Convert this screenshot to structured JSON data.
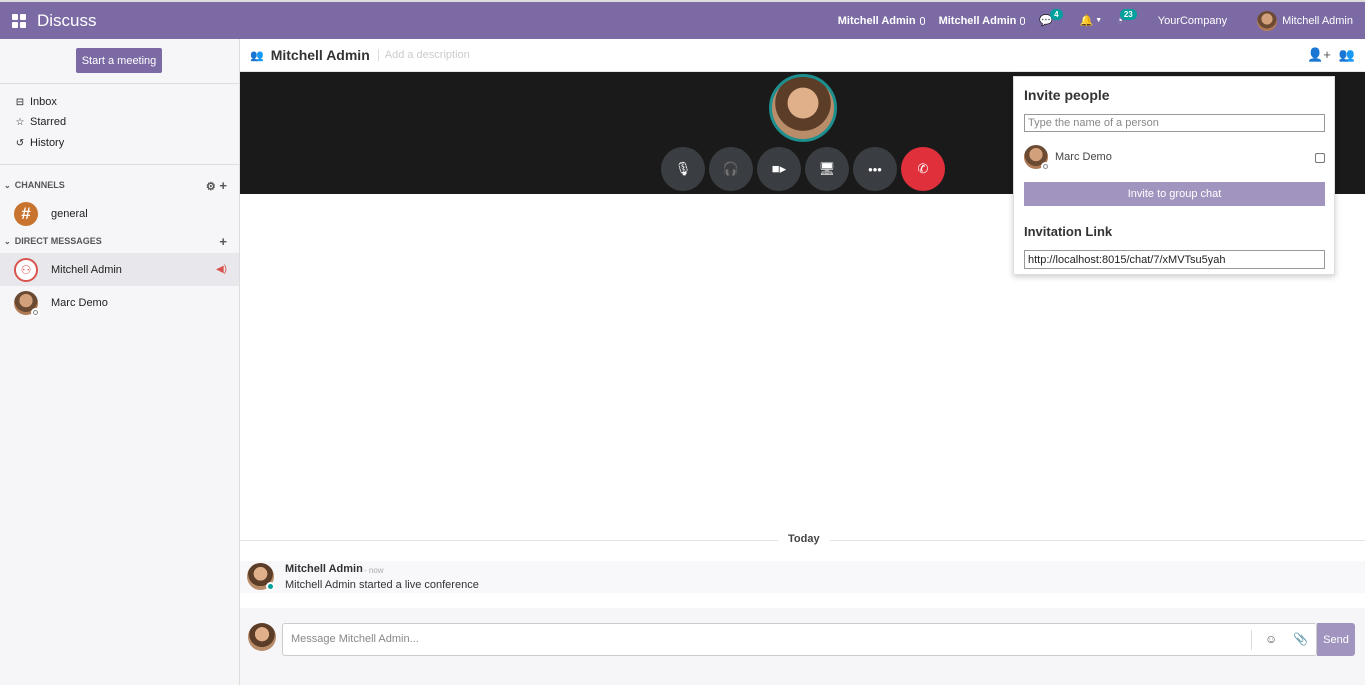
{
  "app": {
    "title": "Discuss"
  },
  "topbar": {
    "call_user_1": "Mitchell Admin",
    "call_user_2": "Mitchell Admin",
    "messages_badge": "4",
    "activities_badge": "23",
    "company": "YourCompany",
    "user": "Mitchell Admin"
  },
  "sidebar": {
    "start_meeting": "Start a meeting",
    "nav": [
      {
        "label": "Inbox",
        "icon": "inbox-icon"
      },
      {
        "label": "Starred",
        "icon": "star-icon"
      },
      {
        "label": "History",
        "icon": "history-icon"
      }
    ],
    "channels_header": "CHANNELS",
    "channels": [
      {
        "label": "general"
      }
    ],
    "dm_header": "DIRECT MESSAGES",
    "direct_messages": [
      {
        "label": "Mitchell Admin",
        "active": true
      },
      {
        "label": "Marc Demo",
        "active": false
      }
    ]
  },
  "thread": {
    "title": "Mitchell Admin",
    "description_placeholder": "Add a description"
  },
  "invite": {
    "title": "Invite people",
    "search_placeholder": "Type the name of a person",
    "people": [
      {
        "name": "Marc Demo",
        "checked": false
      }
    ],
    "invite_button": "Invite to group chat",
    "link_title": "Invitation Link",
    "link_value": "http://localhost:8015/chat/7/xMVTsu5yah"
  },
  "messages": {
    "divider": "Today",
    "items": [
      {
        "author": "Mitchell Admin",
        "time": "- now",
        "body": "Mitchell Admin started a live conference"
      }
    ]
  },
  "composer": {
    "placeholder": "Message Mitchell Admin...",
    "send_label": "Send"
  },
  "colors": {
    "brand": "#7c6aa5",
    "accent": "#00a09d",
    "danger": "#e0303b"
  }
}
